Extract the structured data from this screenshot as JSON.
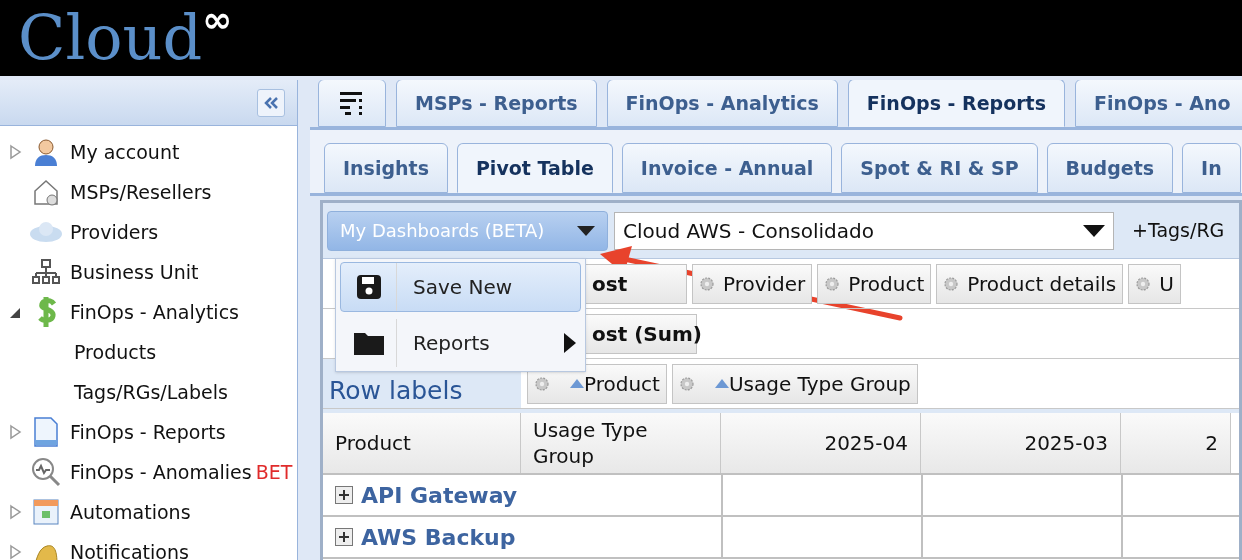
{
  "header": {
    "logo": "Cloud",
    "logo_mark": "∞"
  },
  "sidebar": {
    "items": [
      {
        "label": "My account",
        "expandable": true,
        "expanded": false
      },
      {
        "label": "MSPs/Resellers",
        "expandable": false,
        "expanded": false
      },
      {
        "label": "Providers",
        "expandable": false,
        "expanded": false
      },
      {
        "label": "Business Unit",
        "expandable": false,
        "expanded": false
      },
      {
        "label": "FinOps - Analytics",
        "expandable": true,
        "expanded": true,
        "children": [
          {
            "label": "Products"
          },
          {
            "label": "Tags/RGs/Labels"
          }
        ]
      },
      {
        "label": "FinOps - Reports",
        "expandable": true,
        "expanded": false
      },
      {
        "label": "FinOps - Anomalies",
        "badge": "BET",
        "expandable": false,
        "expanded": false
      },
      {
        "label": "Automations",
        "expandable": true,
        "expanded": false
      },
      {
        "label": "Notifications",
        "expandable": true,
        "expanded": false
      }
    ]
  },
  "top_tabs": [
    {
      "label": "MSPs - Reports",
      "selected": false
    },
    {
      "label": "FinOps - Analytics",
      "selected": false
    },
    {
      "label": "FinOps - Reports",
      "selected": true
    },
    {
      "label": "FinOps - Ano",
      "selected": false
    }
  ],
  "sub_tabs": [
    {
      "label": "Insights",
      "selected": false
    },
    {
      "label": "Pivot Table",
      "selected": true
    },
    {
      "label": "Invoice - Annual",
      "selected": false
    },
    {
      "label": "Spot & RI & SP",
      "selected": false
    },
    {
      "label": "Budgets",
      "selected": false
    },
    {
      "label": "In",
      "selected": false
    }
  ],
  "toolbar": {
    "dashboards_button": "My Dashboards (BETA)",
    "datasource": "Cloud AWS - Consolidado",
    "tags_button": "+Tags/RG"
  },
  "dashboards_menu": [
    {
      "label": "Save New",
      "selected": true,
      "has_submenu": false
    },
    {
      "label": "Reports",
      "selected": false,
      "has_submenu": true
    }
  ],
  "column_fields": [
    "ost",
    "Provider",
    "Product",
    "Product details",
    "U"
  ],
  "value_fields": [
    "ost (Sum)"
  ],
  "row_labels_title": "Row labels",
  "row_fields": [
    {
      "label": "Product",
      "sort_ascending": true
    },
    {
      "label": "Usage Type Group",
      "sort_ascending": true
    }
  ],
  "table": {
    "columns": [
      "Product",
      "Usage Type Group",
      "2025-04",
      "2025-03",
      "2"
    ],
    "rows": [
      {
        "label": "API Gateway",
        "expanded": false
      },
      {
        "label": "AWS Backup",
        "expanded": false
      }
    ]
  }
}
